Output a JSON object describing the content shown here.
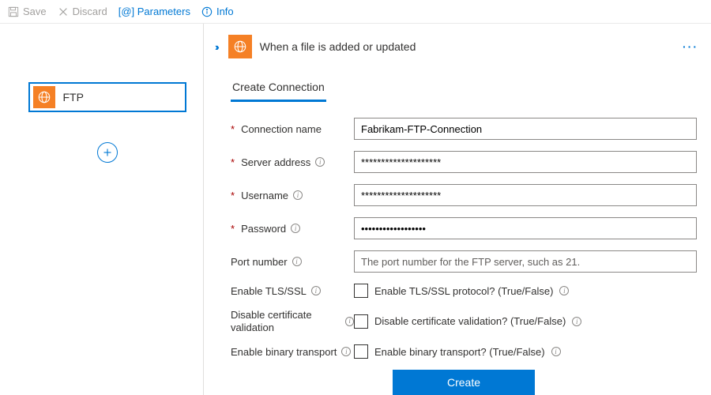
{
  "toolbar": {
    "save": "Save",
    "discard": "Discard",
    "parameters": "[@] Parameters",
    "info_icon_label": "Info"
  },
  "sidebar": {
    "step_label": "FTP"
  },
  "header": {
    "title": "When a file is added or updated"
  },
  "tabs": {
    "create_connection": "Create Connection"
  },
  "form": {
    "connection_name": {
      "label": "Connection name",
      "value": "Fabrikam-FTP-Connection"
    },
    "server_address": {
      "label": "Server address",
      "value": "********************"
    },
    "username": {
      "label": "Username",
      "value": "********************"
    },
    "password": {
      "label": "Password",
      "value": "••••••••••••••••••"
    },
    "port_number": {
      "label": "Port number",
      "placeholder": "The port number for the FTP server, such as 21."
    },
    "enable_tls": {
      "label": "Enable TLS/SSL",
      "checkbox_label": "Enable TLS/SSL protocol? (True/False)"
    },
    "disable_cert": {
      "label": "Disable certificate validation",
      "checkbox_label": "Disable certificate validation? (True/False)"
    },
    "enable_binary": {
      "label": "Enable binary transport",
      "checkbox_label": "Enable binary transport? (True/False)"
    }
  },
  "buttons": {
    "create": "Create"
  }
}
